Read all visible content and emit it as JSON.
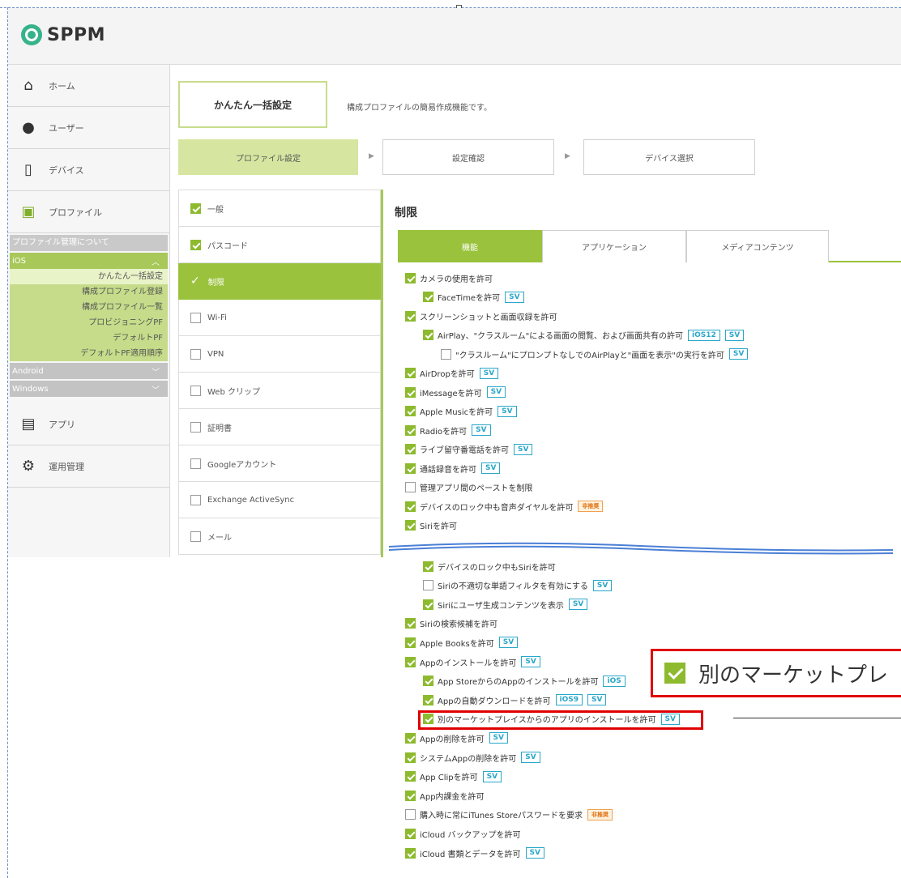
{
  "app": {
    "logo": "SPPM"
  },
  "nav": {
    "items_top": [
      {
        "label": "ホーム",
        "icon": "home-icon"
      },
      {
        "label": "ユーザー",
        "icon": "user-icon"
      },
      {
        "label": "デバイス",
        "icon": "device-icon"
      },
      {
        "label": "プロファイル",
        "icon": "profile-icon"
      }
    ],
    "profile_about": "プロファイル管理について",
    "ios_label": "iOS",
    "ios_links": [
      "かんたん一括設定",
      "構成プロファイル登録",
      "構成プロファイル一覧",
      "プロビジョニングPF",
      "デフォルトPF",
      "デフォルトPF適用順序"
    ],
    "android_label": "Android",
    "windows_label": "Windows",
    "items_bottom": [
      {
        "label": "アプリ",
        "icon": "app-icon"
      },
      {
        "label": "運用管理",
        "icon": "settings-icon"
      }
    ]
  },
  "main": {
    "quick_title": "かんたん一括設定",
    "quick_desc": "構成プロファイルの簡易作成機能です。",
    "steps": [
      "プロファイル設定",
      "設定確認",
      "デバイス選択"
    ],
    "step_arrow": "▶",
    "menu": [
      {
        "label": "一般",
        "checked": true
      },
      {
        "label": "パスコード",
        "checked": true
      },
      {
        "label": "制限",
        "checked": true,
        "active": true
      },
      {
        "label": "Wi-Fi",
        "checked": false
      },
      {
        "label": "VPN",
        "checked": false
      },
      {
        "label": "Web クリップ",
        "checked": false
      },
      {
        "label": "証明書",
        "checked": false
      },
      {
        "label": "Googleアカウント",
        "checked": false
      },
      {
        "label": "Exchange ActiveSync",
        "checked": false
      },
      {
        "label": "メール",
        "checked": false
      }
    ],
    "panel_title": "制限",
    "tabs": [
      "機能",
      "アプリケーション",
      "メディアコンテンツ"
    ]
  },
  "restrictions_top": [
    {
      "label": "カメラの使用を許可",
      "checked": true,
      "indent": 0
    },
    {
      "label": "FaceTimeを許可",
      "checked": true,
      "indent": 1,
      "tags": [
        "SV"
      ]
    },
    {
      "label": "スクリーンショットと画面収録を許可",
      "checked": true,
      "indent": 0
    },
    {
      "label": "AirPlay、\"クラスルーム\"による画面の閲覧、および画面共有の許可",
      "checked": true,
      "indent": 1,
      "tags": [
        "iOS12",
        "SV"
      ]
    },
    {
      "label": "\"クラスルーム\"にプロンプトなしでのAirPlayと\"画面を表示\"の実行を許可",
      "checked": false,
      "indent": 2,
      "tags": [
        "SV"
      ]
    },
    {
      "label": "AirDropを許可",
      "checked": true,
      "indent": 0,
      "tags": [
        "SV"
      ]
    },
    {
      "label": "iMessageを許可",
      "checked": true,
      "indent": 0,
      "tags": [
        "SV"
      ]
    },
    {
      "label": "Apple Musicを許可",
      "checked": true,
      "indent": 0,
      "tags": [
        "SV"
      ]
    },
    {
      "label": "Radioを許可",
      "checked": true,
      "indent": 0,
      "tags": [
        "SV"
      ]
    },
    {
      "label": "ライブ留守番電話を許可",
      "checked": true,
      "indent": 0,
      "tags": [
        "SV"
      ]
    },
    {
      "label": "通話録音を許可",
      "checked": true,
      "indent": 0,
      "tags": [
        "SV"
      ]
    },
    {
      "label": "管理アプリ間のペーストを制限",
      "checked": false,
      "indent": 0
    },
    {
      "label": "デバイスのロック中も音声ダイヤルを許可",
      "checked": true,
      "indent": 0,
      "tags": [
        "非推奨"
      ]
    },
    {
      "label": "Siriを許可",
      "checked": true,
      "indent": 0
    }
  ],
  "restrictions_bottom": [
    {
      "label": "デバイスのロック中もSiriを許可",
      "checked": true,
      "indent": 1
    },
    {
      "label": "Siriの不適切な単語フィルタを有効にする",
      "checked": false,
      "indent": 1,
      "tags": [
        "SV"
      ]
    },
    {
      "label": "Siriにユーザ生成コンテンツを表示",
      "checked": true,
      "indent": 1,
      "tags": [
        "SV"
      ]
    },
    {
      "label": "Siriの検索候補を許可",
      "checked": true,
      "indent": 0
    },
    {
      "label": "Apple Booksを許可",
      "checked": true,
      "indent": 0,
      "tags": [
        "SV"
      ]
    },
    {
      "label": "Appのインストールを許可",
      "checked": true,
      "indent": 0,
      "tags": [
        "SV"
      ]
    },
    {
      "label": "App StoreからのAppのインストールを許可",
      "checked": true,
      "indent": 1,
      "tags": [
        "iOS"
      ]
    },
    {
      "label": "Appの自動ダウンロードを許可",
      "checked": true,
      "indent": 1,
      "tags": [
        "iOS9",
        "SV"
      ]
    },
    {
      "label": "別のマーケットプレイスからのアプリのインストールを許可",
      "checked": true,
      "indent": 1,
      "tags": [
        "SV"
      ]
    },
    {
      "label": "Appの削除を許可",
      "checked": true,
      "indent": 0,
      "tags": [
        "SV"
      ]
    },
    {
      "label": "システムAppの削除を許可",
      "checked": true,
      "indent": 0,
      "tags": [
        "SV"
      ]
    },
    {
      "label": "App Clipを許可",
      "checked": true,
      "indent": 0,
      "tags": [
        "SV"
      ]
    },
    {
      "label": "App内課金を許可",
      "checked": true,
      "indent": 0
    },
    {
      "label": "購入時に常にiTunes Storeパスワードを要求",
      "checked": false,
      "indent": 0,
      "tags": [
        "非推奨"
      ]
    },
    {
      "label": "iCloud バックアップを許可",
      "checked": true,
      "indent": 0
    },
    {
      "label": "iCloud 書類とデータを許可",
      "checked": true,
      "indent": 0,
      "tags": [
        "SV"
      ]
    }
  ],
  "callout": {
    "text": "別のマーケットプレ"
  },
  "colors": {
    "accent": "#9ac23c",
    "highlight": "#e00000",
    "tag": "#2aa7c9"
  }
}
